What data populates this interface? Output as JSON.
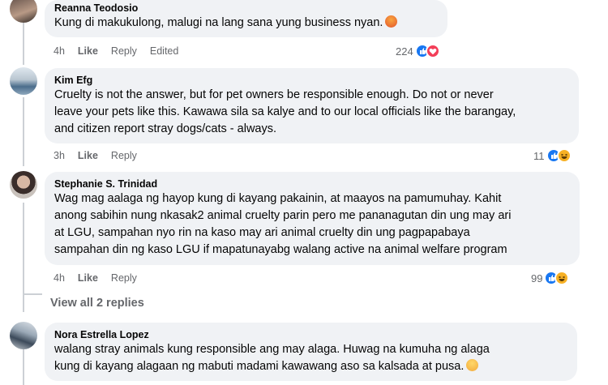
{
  "comments": [
    {
      "author": "Reanna Teodosio",
      "lines": [
        "Kung di makukulong, malugi na lang sana yung business nyan."
      ],
      "time": "4h",
      "like": "Like",
      "reply": "Reply",
      "edited": "Edited",
      "reaction_count": "224",
      "reactions": [
        "like-icon",
        "love-icon"
      ]
    },
    {
      "author": "Kim Efg",
      "lines": [
        "Cruelty is not the answer, but for pet owners be responsible enough. Do not or never",
        "leave your pets like this. Kawawa sila sa kalye and to our local officials like the barangay,",
        "and citizen report stray dogs/cats - always."
      ],
      "time": "3h",
      "like": "Like",
      "reply": "Reply",
      "reaction_count": "11",
      "reactions": [
        "like-icon",
        "haha-icon"
      ]
    },
    {
      "author": "Stephanie S. Trinidad",
      "lines": [
        "Wag mag aalaga ng hayop kung di kayang pakainin, at maayos na pamumuhay. Kahit",
        "anong sabihin nung nkasak2 animal cruelty parin pero me pananagutan din ung may ari",
        "at LGU, sampahan nyo rin na kaso may ari animal cruelty din ung pagpapabaya",
        "sampahan din ng kaso LGU if mapatunayabg walang active na animal welfare program"
      ],
      "time": "4h",
      "like": "Like",
      "reply": "Reply",
      "reaction_count": "99",
      "reactions": [
        "like-icon",
        "haha-icon"
      ]
    },
    {
      "view_replies": "View all 2 replies"
    },
    {
      "author": "Nora Estrella Lopez",
      "lines": [
        "walang stray animals kung responsible ang may alaga. Huwag na kumuha ng alaga",
        "kung di kayang alagaan ng mabuti madami kawawang aso sa kalsada at pusa."
      ]
    }
  ],
  "colors": {
    "like_blue": "#1877f2",
    "love_red": "#f33e58",
    "haha_yellow": "#f7b125",
    "bubble_bg": "#f0f2f5",
    "meta_gray": "#65676b"
  }
}
